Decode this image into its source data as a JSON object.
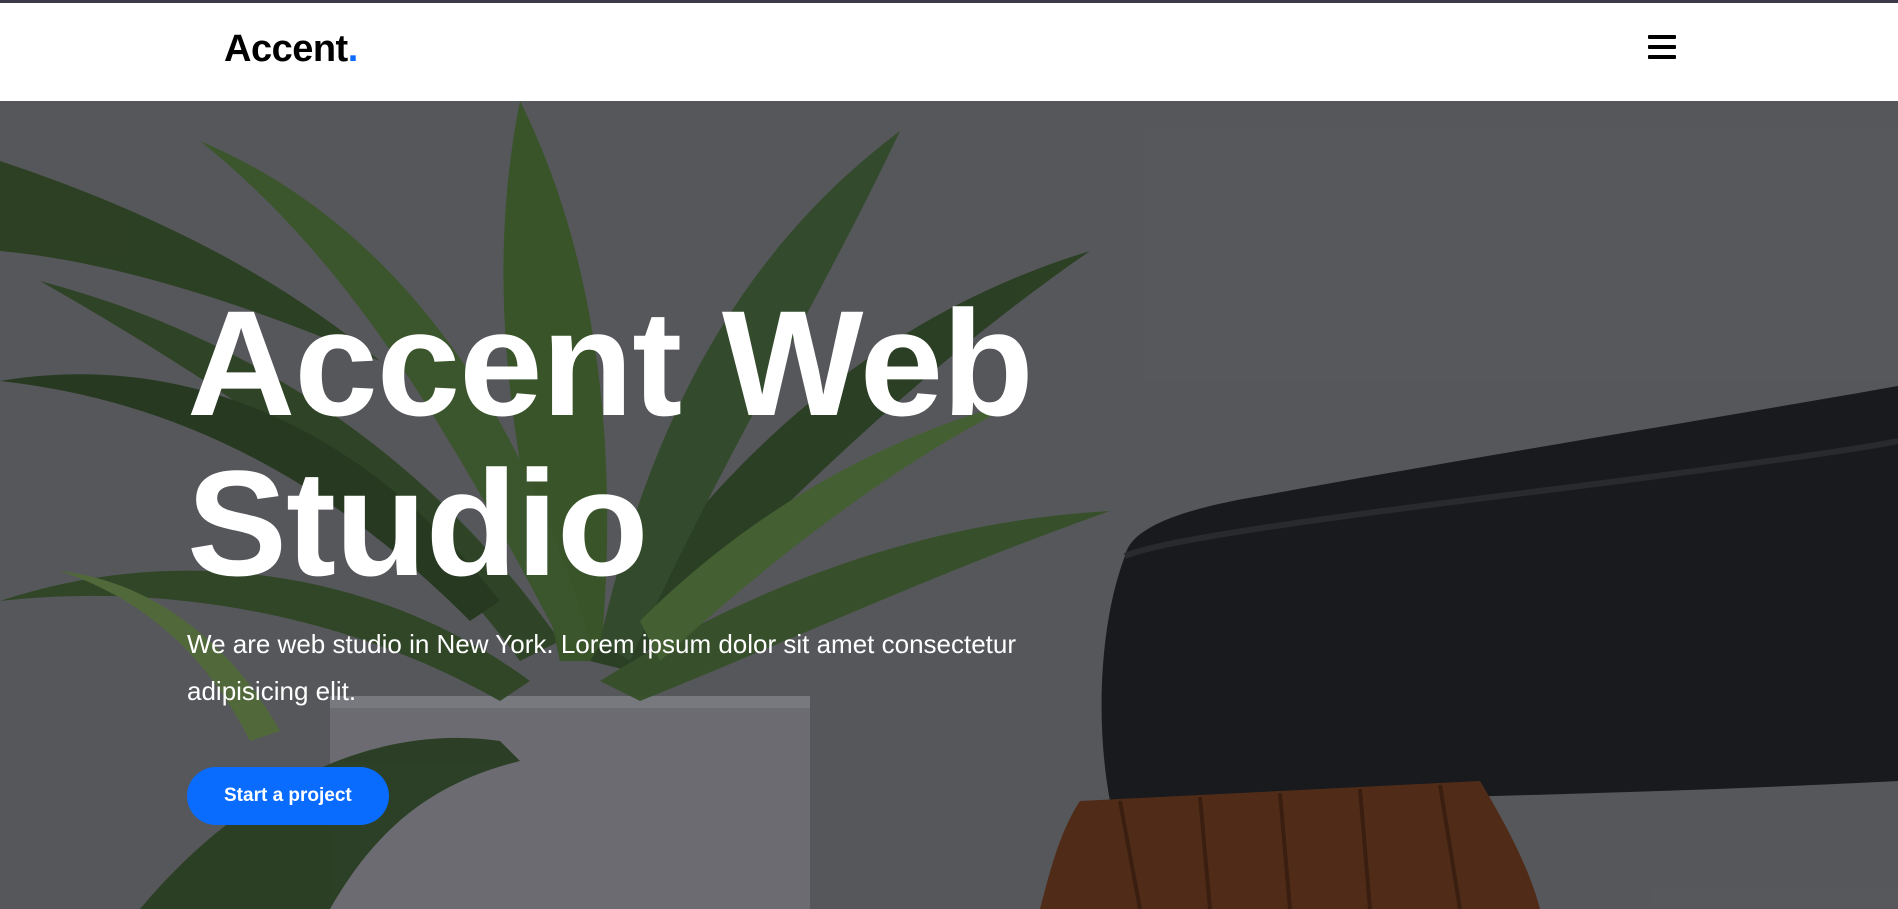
{
  "header": {
    "logo_text": "Accent",
    "logo_dot": ".",
    "menu_icon": "hamburger-menu-icon"
  },
  "hero": {
    "title_line1": "Accent Web",
    "title_line2": "Studio",
    "subtitle": "We are web studio in New York. Lorem ipsum dolor sit amet consectetur adipisicing elit.",
    "cta_label": "Start a project",
    "background_image": "plant-and-leather-chair-photo"
  },
  "colors": {
    "accent": "#0a6cff",
    "header_bg": "#ffffff",
    "hero_text": "#ffffff"
  }
}
